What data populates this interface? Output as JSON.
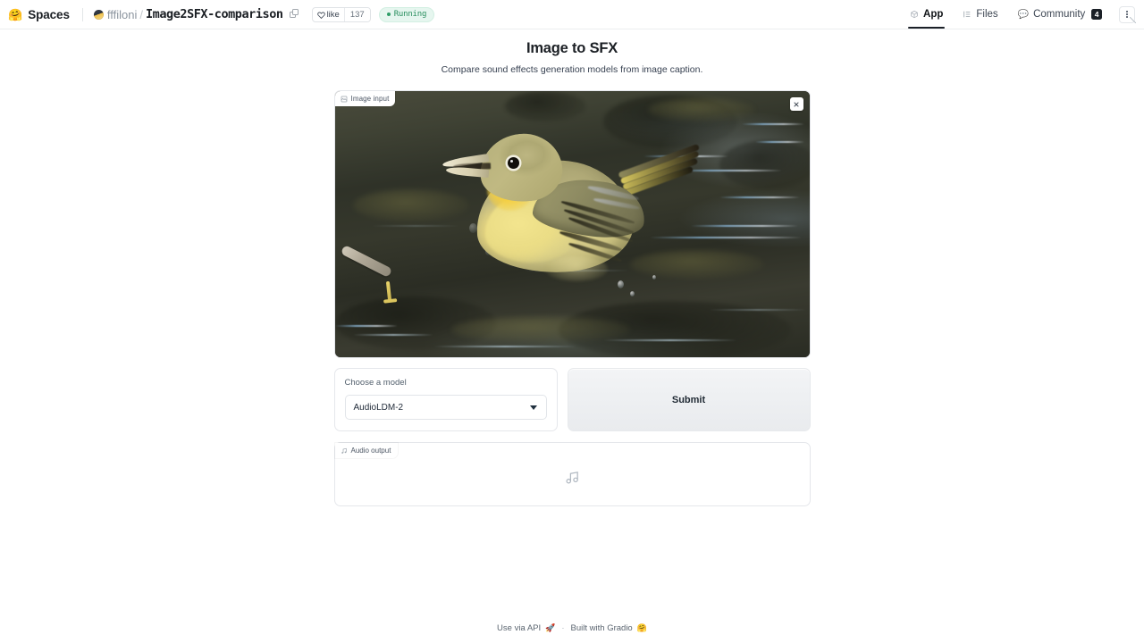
{
  "topbar": {
    "logo_icon": "hugging-face-logo",
    "product": "Spaces",
    "owner": "fffiloni",
    "separator": "/",
    "repo": "Image2SFX-comparison",
    "copy_icon": "copy-icon",
    "like_label": "like",
    "like_icon": "heart-icon",
    "like_count": "137",
    "status": "Running",
    "tabs": [
      {
        "label": "App",
        "icon": "cube-icon",
        "active": true
      },
      {
        "label": "Files",
        "icon": "files-icon",
        "active": false
      },
      {
        "label": "Community",
        "icon": "community-icon",
        "active": false,
        "badge": "4"
      }
    ],
    "menu_icon": "kebab-menu-icon"
  },
  "app": {
    "title": "Image to SFX",
    "subtitle": "Compare sound effects generation models from image caption."
  },
  "image_input": {
    "tag_label": "Image input",
    "tag_icon": "image-icon",
    "clear_icon": "close-icon",
    "alt": "A yellow warbler bird standing in shallow dark water with splashes"
  },
  "model": {
    "label": "Choose a model",
    "selected": "AudioLDM-2",
    "caret_icon": "chevron-down-icon"
  },
  "submit": {
    "label": "Submit"
  },
  "audio_output": {
    "tag_label": "Audio output",
    "tag_icon": "music-note-icon",
    "placeholder_icon": "music-note-icon"
  },
  "footer": {
    "api_label": "Use via API",
    "api_emoji": "🚀",
    "separator": "·",
    "built_label": "Built with Gradio",
    "built_emoji": "🤗"
  },
  "colors": {
    "accent_dark": "#1b2027",
    "status_green": "#2a8f5f",
    "status_bg": "#e6f6ef",
    "border": "#e5e7eb",
    "muted_text": "#8c959f"
  }
}
